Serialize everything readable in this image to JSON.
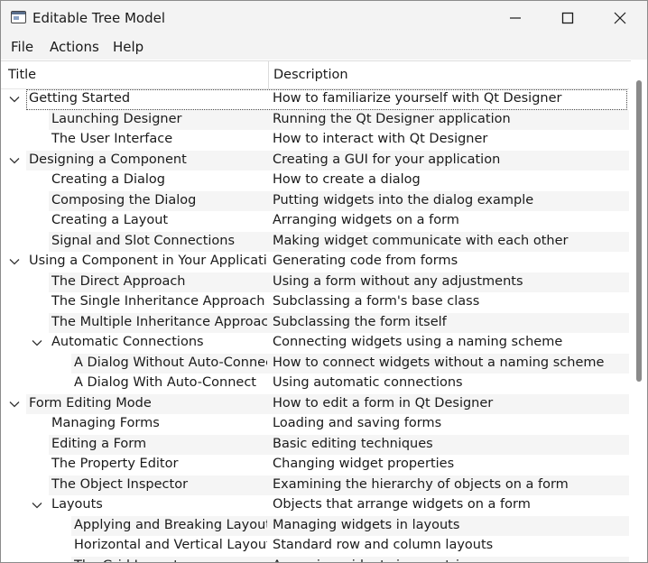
{
  "window": {
    "title": "Editable Tree Model",
    "icon": "window-app-icon",
    "controls": [
      "minimize-icon",
      "maximize-icon",
      "close-icon"
    ]
  },
  "menu": [
    "File",
    "Actions",
    "Help"
  ],
  "columns": [
    "Title",
    "Description"
  ],
  "rows": [
    {
      "title": "Getting Started",
      "desc": "How to familiarize yourself with Qt Designer",
      "depth": 0,
      "expanded": true,
      "selected": true
    },
    {
      "title": "Launching Designer",
      "desc": "Running the Qt Designer application",
      "depth": 1
    },
    {
      "title": "The User Interface",
      "desc": "How to interact with Qt Designer",
      "depth": 1
    },
    {
      "title": "Designing a Component",
      "desc": "Creating a GUI for your application",
      "depth": 0,
      "expanded": true
    },
    {
      "title": "Creating a Dialog",
      "desc": "How to create a dialog",
      "depth": 1
    },
    {
      "title": "Composing the Dialog",
      "desc": "Putting widgets into the dialog example",
      "depth": 1
    },
    {
      "title": "Creating a Layout",
      "desc": "Arranging widgets on a form",
      "depth": 1
    },
    {
      "title": "Signal and Slot Connections",
      "desc": "Making widget communicate with each other",
      "depth": 1
    },
    {
      "title": "Using a Component in Your Application",
      "desc": "Generating code from forms",
      "depth": 0,
      "expanded": true
    },
    {
      "title": "The Direct Approach",
      "desc": "Using a form without any adjustments",
      "depth": 1
    },
    {
      "title": "The Single Inheritance Approach",
      "desc": "Subclassing a form's base class",
      "depth": 1
    },
    {
      "title": "The Multiple Inheritance Approach",
      "desc": "Subclassing the form itself",
      "depth": 1
    },
    {
      "title": "Automatic Connections",
      "desc": "Connecting widgets using a naming scheme",
      "depth": 1,
      "expanded": true
    },
    {
      "title": "A Dialog Without Auto-Connect",
      "desc": "How to connect widgets without a naming scheme",
      "depth": 2
    },
    {
      "title": "A Dialog With Auto-Connect",
      "desc": "Using automatic connections",
      "depth": 2
    },
    {
      "title": "Form Editing Mode",
      "desc": "How to edit a form in Qt Designer",
      "depth": 0,
      "expanded": true
    },
    {
      "title": "Managing Forms",
      "desc": "Loading and saving forms",
      "depth": 1
    },
    {
      "title": "Editing a Form",
      "desc": "Basic editing techniques",
      "depth": 1
    },
    {
      "title": "The Property Editor",
      "desc": "Changing widget properties",
      "depth": 1
    },
    {
      "title": "The Object Inspector",
      "desc": "Examining the hierarchy of objects on a form",
      "depth": 1
    },
    {
      "title": "Layouts",
      "desc": "Objects that arrange widgets on a form",
      "depth": 1,
      "expanded": true
    },
    {
      "title": "Applying and Breaking Layouts",
      "desc": "Managing widgets in layouts",
      "depth": 2
    },
    {
      "title": "Horizontal and Vertical Layouts",
      "desc": "Standard row and column layouts",
      "depth": 2
    },
    {
      "title": "The Grid Layout",
      "desc": "Arranging widgets in a matrix",
      "depth": 2
    }
  ],
  "scrollbar": {
    "position": 0.0
  }
}
